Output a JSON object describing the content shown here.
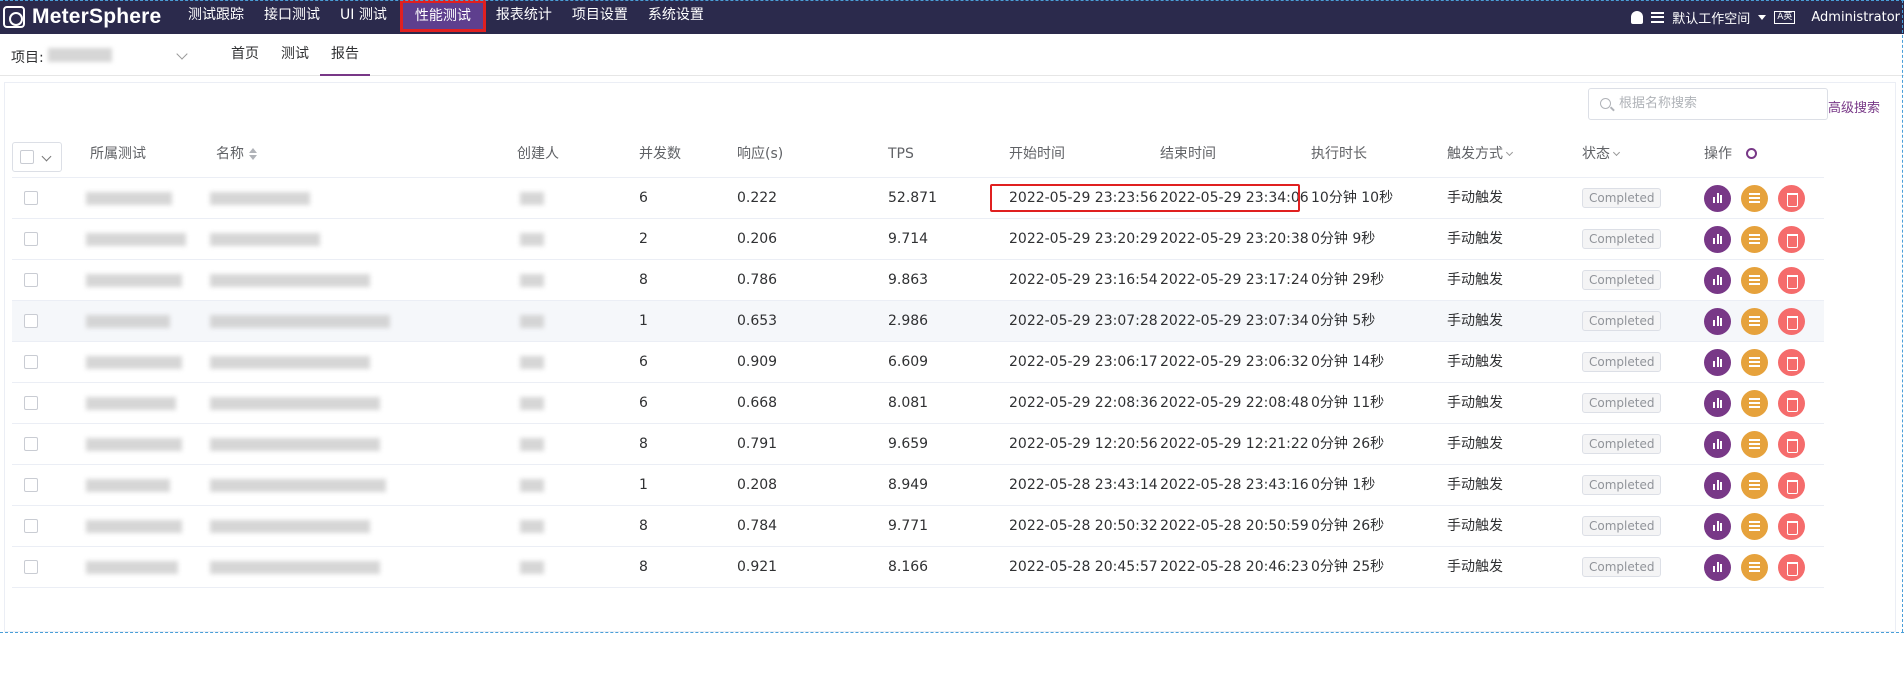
{
  "app": {
    "logo_text": "MeterSphere"
  },
  "nav": {
    "items": [
      "测试跟踪",
      "接口测试",
      "UI 测试",
      "性能测试",
      "报表统计",
      "项目设置",
      "系统设置"
    ],
    "active": "性能测试"
  },
  "top_right": {
    "workspace": "默认工作空间",
    "lang": "A英",
    "user": "Administrator"
  },
  "sub": {
    "project_label": "项目:",
    "tabs": [
      "首页",
      "测试",
      "报告"
    ],
    "active_tab": "报告"
  },
  "search": {
    "placeholder": "根据名称搜索",
    "advanced": "高级搜索"
  },
  "table": {
    "headers": {
      "test": "所属测试",
      "name": "名称",
      "creator": "创建人",
      "concurrency": "并发数",
      "response": "响应(s)",
      "tps": "TPS",
      "start": "开始时间",
      "end": "结束时间",
      "duration": "执行时长",
      "trigger": "触发方式",
      "status": "状态",
      "ops": "操作"
    },
    "rows": [
      {
        "concurrency": "6",
        "response": "0.222",
        "tps": "52.871",
        "start": "2022-05-29 23:23:56",
        "end": "2022-05-29 23:34:06",
        "duration": "10分钟 10秒",
        "trigger": "手动触发",
        "status": "Completed",
        "name_fragment": "..."
      },
      {
        "concurrency": "2",
        "response": "0.206",
        "tps": "9.714",
        "start": "2022-05-29 23:20:29",
        "end": "2022-05-29 23:20:38",
        "duration": "0分钟 9秒",
        "trigger": "手动触发",
        "status": "Completed"
      },
      {
        "concurrency": "8",
        "response": "0.786",
        "tps": "9.863",
        "start": "2022-05-29 23:16:54",
        "end": "2022-05-29 23:17:24",
        "duration": "0分钟 29秒",
        "trigger": "手动触发",
        "status": "Completed"
      },
      {
        "concurrency": "1",
        "response": "0.653",
        "tps": "2.986",
        "start": "2022-05-29 23:07:28",
        "end": "2022-05-29 23:07:34",
        "duration": "0分钟 5秒",
        "trigger": "手动触发",
        "status": "Completed"
      },
      {
        "concurrency": "6",
        "response": "0.909",
        "tps": "6.609",
        "start": "2022-05-29 23:06:17",
        "end": "2022-05-29 23:06:32",
        "duration": "0分钟 14秒",
        "trigger": "手动触发",
        "status": "Completed"
      },
      {
        "concurrency": "6",
        "response": "0.668",
        "tps": "8.081",
        "start": "2022-05-29 22:08:36",
        "end": "2022-05-29 22:08:48",
        "duration": "0分钟 11秒",
        "trigger": "手动触发",
        "status": "Completed"
      },
      {
        "concurrency": "8",
        "response": "0.791",
        "tps": "9.659",
        "start": "2022-05-29 12:20:56",
        "end": "2022-05-29 12:21:22",
        "duration": "0分钟 26秒",
        "trigger": "手动触发",
        "status": "Completed"
      },
      {
        "concurrency": "1",
        "response": "0.208",
        "tps": "8.949",
        "start": "2022-05-28 23:43:14",
        "end": "2022-05-28 23:43:16",
        "duration": "0分钟 1秒",
        "trigger": "手动触发",
        "status": "Completed"
      },
      {
        "concurrency": "8",
        "response": "0.784",
        "tps": "9.771",
        "start": "2022-05-28 20:50:32",
        "end": "2022-05-28 20:50:59",
        "duration": "0分钟 26秒",
        "trigger": "手动触发",
        "status": "Completed"
      },
      {
        "concurrency": "8",
        "response": "0.921",
        "tps": "8.166",
        "start": "2022-05-28 20:45:57",
        "end": "2022-05-28 20:46:23",
        "duration": "0分钟 25秒",
        "trigger": "手动触发",
        "status": "Completed"
      }
    ]
  },
  "colors": {
    "nav_bg": "#2b2a4c",
    "accent": "#783887",
    "warning": "#e6a23c",
    "danger": "#f56c6c",
    "highlight": "#e02020"
  }
}
